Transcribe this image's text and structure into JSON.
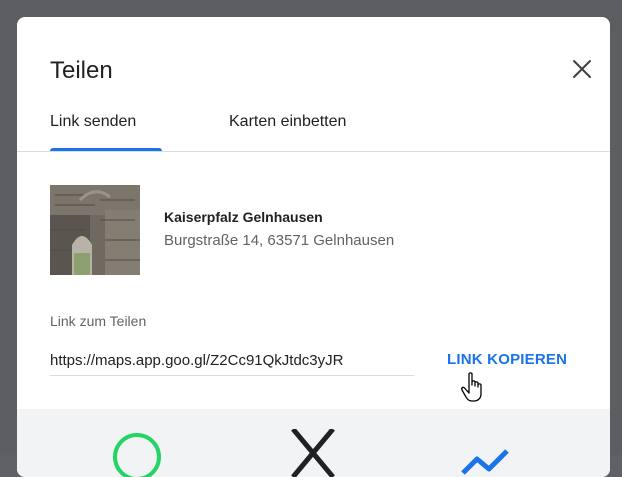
{
  "dialog": {
    "title": "Teilen",
    "close_icon": "close-icon"
  },
  "tabs": [
    {
      "label": "Link senden",
      "active": true
    },
    {
      "label": "Karten einbetten",
      "active": false
    }
  ],
  "place": {
    "name": "Kaiserpfalz Gelnhausen",
    "address": "Burgstraße 14, 63571 Gelnhausen",
    "thumbnail": "photo-thumbnail"
  },
  "share_link": {
    "label": "Link zum Teilen",
    "value": "https://maps.app.goo.gl/Z2Cc91QkJtdc3yJR",
    "copy_label": "LINK KOPIEREN"
  },
  "share_targets": [
    "whatsapp-icon",
    "x-icon",
    "messenger-icon"
  ],
  "colors": {
    "accent": "#1a73e8",
    "text": "#202124",
    "secondary_text": "#5f6368",
    "backdrop": "#5c5e62"
  }
}
